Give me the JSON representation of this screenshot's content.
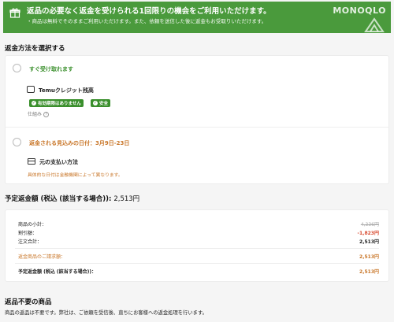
{
  "banner": {
    "title": "返品の必要なく返金を受けられる1回限りの機会をご利用いただけます。",
    "subtitle": "・商品は無料でそのままご利用いただけます。また、依頼を送信した後に返金もお受取りいただけます。",
    "watermark": "MONOQLO"
  },
  "refund_method": {
    "heading": "返金方法を選択する",
    "option1": {
      "title": "すぐ受け取れます",
      "credit_label": "Temuクレジット残高",
      "badge_no_expiry": "有効期限はありません",
      "badge_safe": "安全",
      "howto": "仕組み"
    },
    "option2": {
      "title": "返金される見込みの日付：3月9日-23日",
      "method_label": "元の支払い方法",
      "note": "具体的な日付は金融機関によって異なります。"
    }
  },
  "estimate": {
    "heading_label": "予定返金額 (税込 (該当する場合)):",
    "heading_amount": "2,513円",
    "rows": [
      {
        "label": "商品の小計：",
        "value": "4,336円"
      },
      {
        "label": "割引額：",
        "value": "-1,823円"
      },
      {
        "label": "注文合計：",
        "value": "2,513円"
      }
    ],
    "return_label": "返金商品のご請求額：",
    "return_value": "2,513円",
    "final_label": "予定返金額 (税込 (該当する場合))：",
    "final_value": "2,513円"
  },
  "no_return": {
    "heading": "返品不要の商品",
    "text": "商品の返品は不要です。弊社は、ご依頼を受信後、直ちにお客様への返金処理を行います。"
  }
}
